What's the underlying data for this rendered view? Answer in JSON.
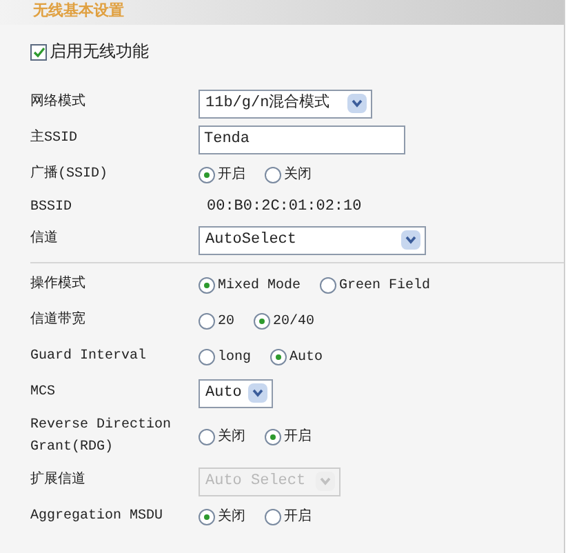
{
  "section_title": "无线基本设置",
  "enable_wireless": {
    "label": "启用无线功能",
    "checked": true
  },
  "rows": [
    {
      "kind": "select",
      "label": "网络模式",
      "value": "11b/g/n混合模式",
      "disabled": false
    },
    {
      "kind": "text",
      "label": "主SSID",
      "value": "Tenda"
    },
    {
      "kind": "radio",
      "label": "广播(SSID)",
      "options": [
        {
          "label": "开启",
          "selected": true
        },
        {
          "label": "关闭",
          "selected": false
        }
      ]
    },
    {
      "kind": "static",
      "label": "BSSID",
      "value": "00:B0:2C:01:02:10"
    },
    {
      "kind": "select",
      "label": "信道",
      "value": "AutoSelect",
      "disabled": false,
      "divider_after": true
    },
    {
      "kind": "radio",
      "label": "操作模式",
      "options": [
        {
          "label": "Mixed Mode",
          "selected": true
        },
        {
          "label": "Green Field",
          "selected": false
        }
      ]
    },
    {
      "kind": "radio",
      "label": "信道带宽",
      "options": [
        {
          "label": "20",
          "selected": false
        },
        {
          "label": "20/40",
          "selected": true
        }
      ]
    },
    {
      "kind": "radio",
      "label": "Guard Interval",
      "options": [
        {
          "label": "long",
          "selected": false
        },
        {
          "label": "Auto",
          "selected": true
        }
      ]
    },
    {
      "kind": "select",
      "label": "MCS",
      "value": "Auto",
      "disabled": false
    },
    {
      "kind": "radio",
      "label": "Reverse Direction Grant(RDG)",
      "options": [
        {
          "label": "关闭",
          "selected": false
        },
        {
          "label": "开启",
          "selected": true
        }
      ]
    },
    {
      "kind": "select",
      "label": "扩展信道",
      "value": "Auto Select",
      "disabled": true
    },
    {
      "kind": "radio",
      "label": "Aggregation MSDU",
      "options": [
        {
          "label": "关闭",
          "selected": true
        },
        {
          "label": "开启",
          "selected": false
        }
      ]
    }
  ]
}
